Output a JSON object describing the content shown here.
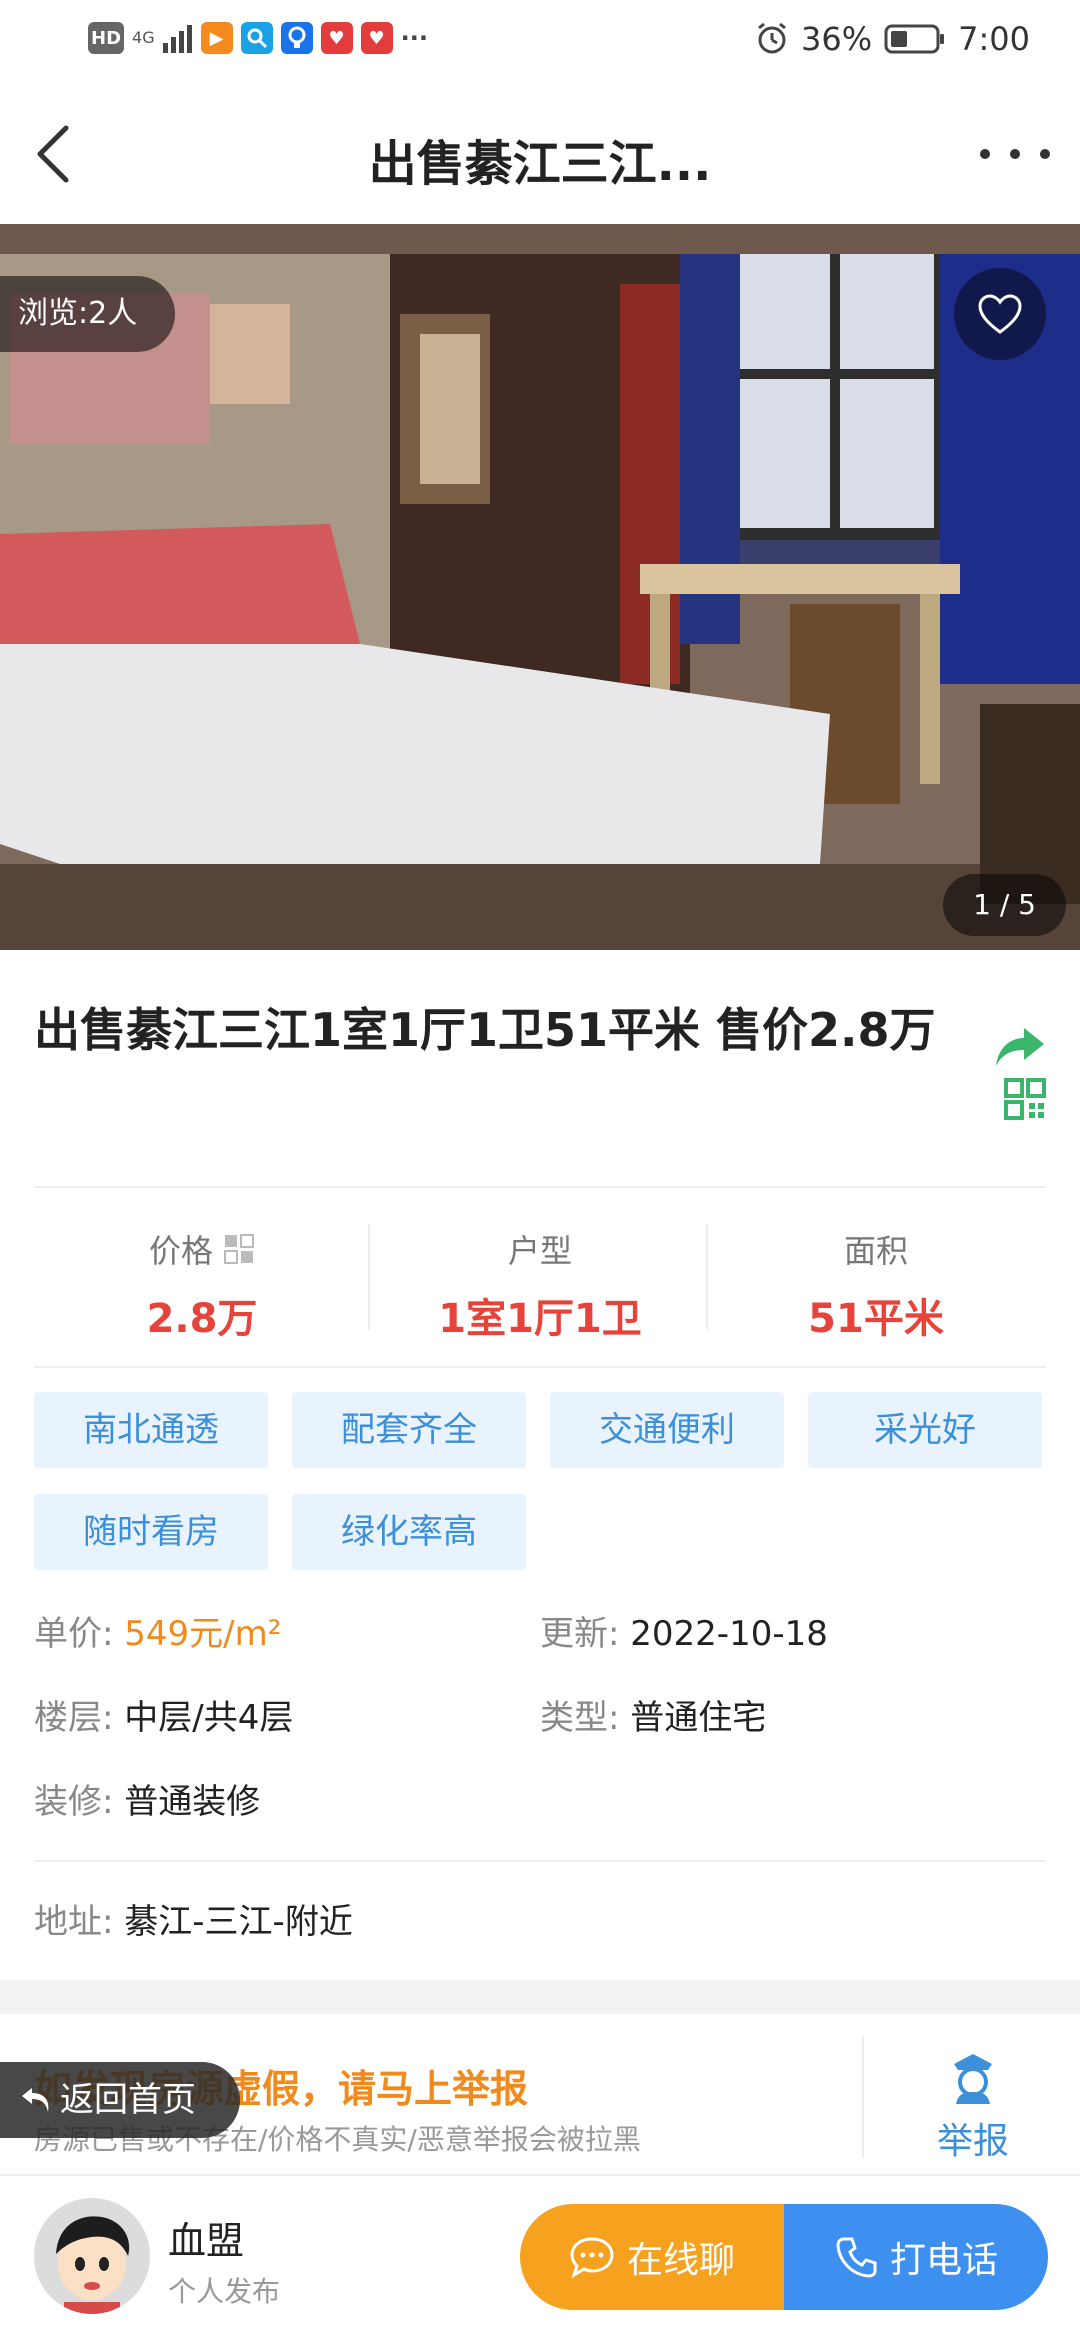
{
  "status_bar": {
    "network_hd": "HD",
    "network_4g": "4G",
    "battery_percent": "36%",
    "time": "7:00",
    "notification_more": "···"
  },
  "nav": {
    "title": "出售綦江三江..."
  },
  "gallery": {
    "views_label": "浏览:2人",
    "photo_counter": "1 / 5"
  },
  "listing": {
    "title": "出售綦江三江1室1厅1卫51平米 售价2.8万"
  },
  "stats": [
    {
      "label": "价格",
      "value": "2.8万"
    },
    {
      "label": "户型",
      "value": "1室1厅1卫"
    },
    {
      "label": "面积",
      "value": "51平米"
    }
  ],
  "tags": [
    "南北通透",
    "配套齐全",
    "交通便利",
    "采光好",
    "随时看房",
    "绿化率高"
  ],
  "details": {
    "unit_price_key": "单价:",
    "unit_price_value": "549元/m²",
    "updated_key": "更新:",
    "updated_value": "2022-10-18",
    "floor_key": "楼层:",
    "floor_value": "中层/共4层",
    "type_key": "类型:",
    "type_value": "普通住宅",
    "decor_key": "装修:",
    "decor_value": "普通装修",
    "address_key": "地址:",
    "address_value": "綦江-三江-附近"
  },
  "report": {
    "title": "如发现房源虚假，请马上举报",
    "subtitle": "房源已售或不存在/价格不真实/恶意举报会被拉黑",
    "button_label": "举报"
  },
  "floating": {
    "back_home": "返回首页"
  },
  "seller": {
    "name": "血盟",
    "type": "个人发布"
  },
  "actions": {
    "chat_label": "在线聊",
    "call_label": "打电话"
  },
  "colors": {
    "accent_red": "#e8433a",
    "accent_orange": "#f08a1c",
    "tag_blue": "#3c8fd9",
    "chat_button": "#f7a21f",
    "call_button": "#3d8ff0",
    "share_green": "#3bb56b"
  }
}
